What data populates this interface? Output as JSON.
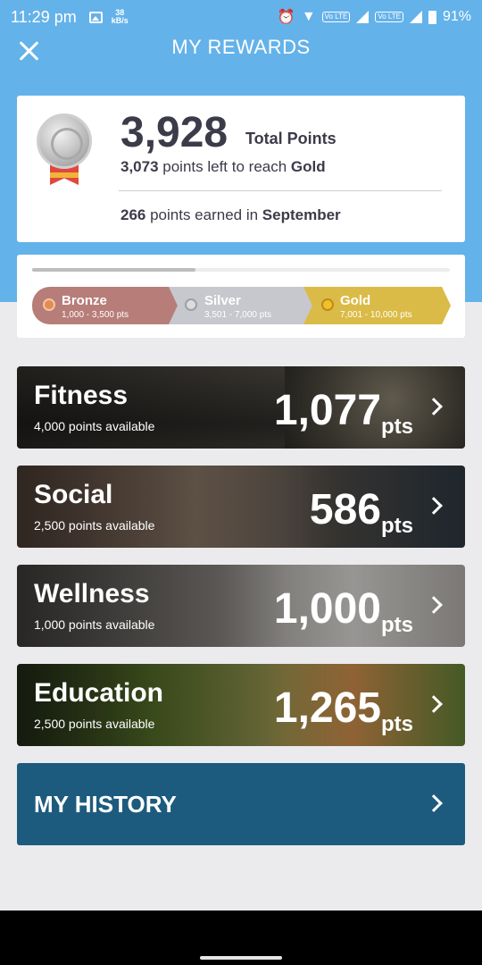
{
  "status_bar": {
    "time": "11:29 pm",
    "net_speed_value": "38",
    "net_speed_unit": "kB/s",
    "volte_1": "Vo LTE",
    "volte_2": "Vo LTE",
    "battery": "91%",
    "icons": [
      "image-icon",
      "alarm-icon",
      "wifi-icon",
      "signal-icon",
      "battery-icon"
    ]
  },
  "header": {
    "title": "MY REWARDS",
    "close_icon": "close-icon",
    "background_color": "#64b2ea"
  },
  "summary": {
    "total_points": "3,928",
    "total_label": "Total Points",
    "points_left": "3,073",
    "points_left_text": " points left to reach ",
    "next_tier": "Gold",
    "earned_points": "266",
    "earned_text": " points earned in ",
    "month": "September",
    "medal_icon": "silver-medal-icon"
  },
  "tiers": {
    "progress_fraction": 0.39,
    "items": [
      {
        "name": "Bronze",
        "range": "1,000 - 3,500 pts",
        "color": "#b77d79",
        "icon": "bronze-medal-icon"
      },
      {
        "name": "Silver",
        "range": "3,501 - 7,000 pts",
        "color": "#c6c8cd",
        "icon": "silver-medal-icon"
      },
      {
        "name": "Gold",
        "range": "7,001 - 10,000 pts",
        "color": "#dbbb47",
        "icon": "gold-medal-icon"
      }
    ]
  },
  "categories": [
    {
      "name": "Fitness",
      "available": "4,000 points available",
      "points": "1,077",
      "unit": "pts"
    },
    {
      "name": "Social",
      "available": "2,500 points available",
      "points": "586",
      "unit": "pts"
    },
    {
      "name": "Wellness",
      "available": "1,000 points available",
      "points": "1,000",
      "unit": "pts"
    },
    {
      "name": "Education",
      "available": "2,500 points available",
      "points": "1,265",
      "unit": "pts"
    }
  ],
  "history": {
    "label": "MY HISTORY",
    "color": "#1d5b7e"
  }
}
